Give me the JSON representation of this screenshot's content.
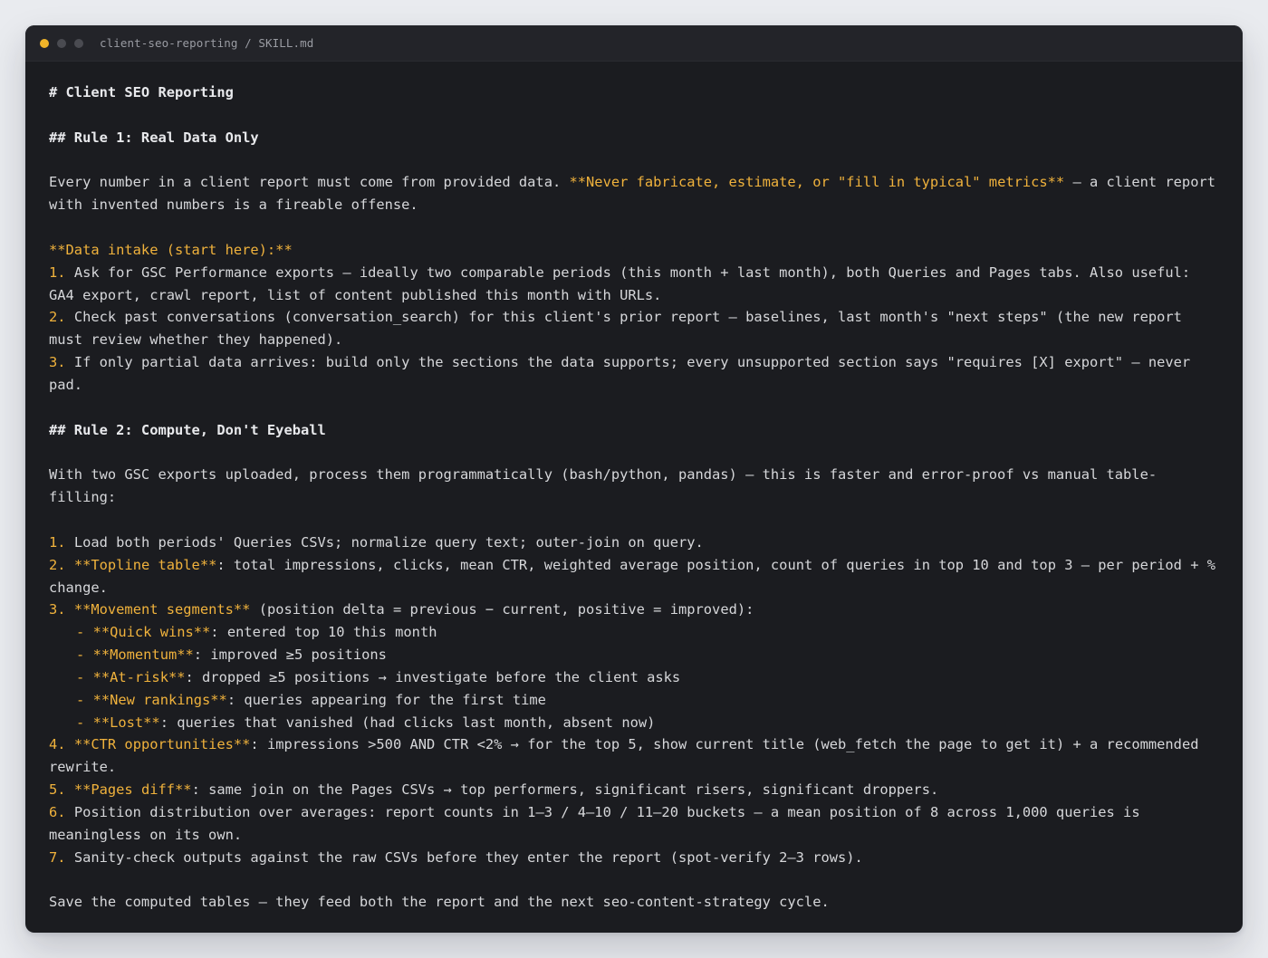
{
  "window": {
    "path": "client-seo-reporting / SKILL.md",
    "accent_color": "#f0b23c",
    "background_color": "#1b1c20"
  },
  "doc": {
    "h1": "# Client SEO Reporting",
    "rule1_heading": "## Rule 1: Real Data Only",
    "rule1_p_before": "Every number in a client report must come from provided data. ",
    "rule1_p_bold": "**Never fabricate, estimate, or \"fill in typical\" metrics**",
    "rule1_p_after": " — a client report with invented numbers is a fireable offense.",
    "intake_label": "**Data intake (start here):**",
    "intake_items": [
      {
        "num": "1.",
        "text": " Ask for GSC Performance exports — ideally two comparable periods (this month + last month), both Queries and Pages tabs. Also useful: GA4 export, crawl report, list of content published this month with URLs."
      },
      {
        "num": "2.",
        "text": " Check past conversations (conversation_search) for this client's prior report — baselines, last month's \"next steps\" (the new report must review whether they happened)."
      },
      {
        "num": "3.",
        "text": " If only partial data arrives: build only the sections the data supports; every unsupported section says \"requires [X] export\" — never pad."
      }
    ],
    "rule2_heading": "## Rule 2: Compute, Don't Eyeball",
    "rule2_p": "With two GSC exports uploaded, process them programmatically (bash/python, pandas) — this is faster and error-proof vs manual table-filling:",
    "steps": {
      "s1": {
        "num": "1.",
        "text": " Load both periods' Queries CSVs; normalize query text; outer-join on query."
      },
      "s2": {
        "num": "2.",
        "bold": "**Topline table**",
        "text": ": total impressions, clicks, mean CTR, weighted average position, count of queries in top 10 and top 3 — per period + % change."
      },
      "s3": {
        "num": "3.",
        "bold": "**Movement segments**",
        "text": " (position delta = previous − current, positive = improved):"
      },
      "segments": [
        {
          "dash": "-",
          "bold": "**Quick wins**",
          "text": ": entered top 10 this month"
        },
        {
          "dash": "-",
          "bold": "**Momentum**",
          "text": ": improved ≥5 positions"
        },
        {
          "dash": "-",
          "bold": "**At-risk**",
          "text": ": dropped ≥5 positions → investigate before the client asks"
        },
        {
          "dash": "-",
          "bold": "**New rankings**",
          "text": ": queries appearing for the first time"
        },
        {
          "dash": "-",
          "bold": "**Lost**",
          "text": ": queries that vanished (had clicks last month, absent now)"
        }
      ],
      "s4": {
        "num": "4.",
        "bold": "**CTR opportunities**",
        "text": ": impressions >500 AND CTR <2% → for the top 5, show current title (web_fetch the page to get it) + a recommended rewrite."
      },
      "s5": {
        "num": "5.",
        "bold": "**Pages diff**",
        "text": ": same join on the Pages CSVs → top performers, significant risers, significant droppers."
      },
      "s6": {
        "num": "6.",
        "text": " Position distribution over averages: report counts in 1–3 / 4–10 / 11–20 buckets — a mean position of 8 across 1,000 queries is meaningless on its own."
      },
      "s7": {
        "num": "7.",
        "text": " Sanity-check outputs against the raw CSVs before they enter the report (spot-verify 2–3 rows)."
      }
    },
    "closing": "Save the computed tables — they feed both the report and the next seo-content-strategy cycle."
  }
}
